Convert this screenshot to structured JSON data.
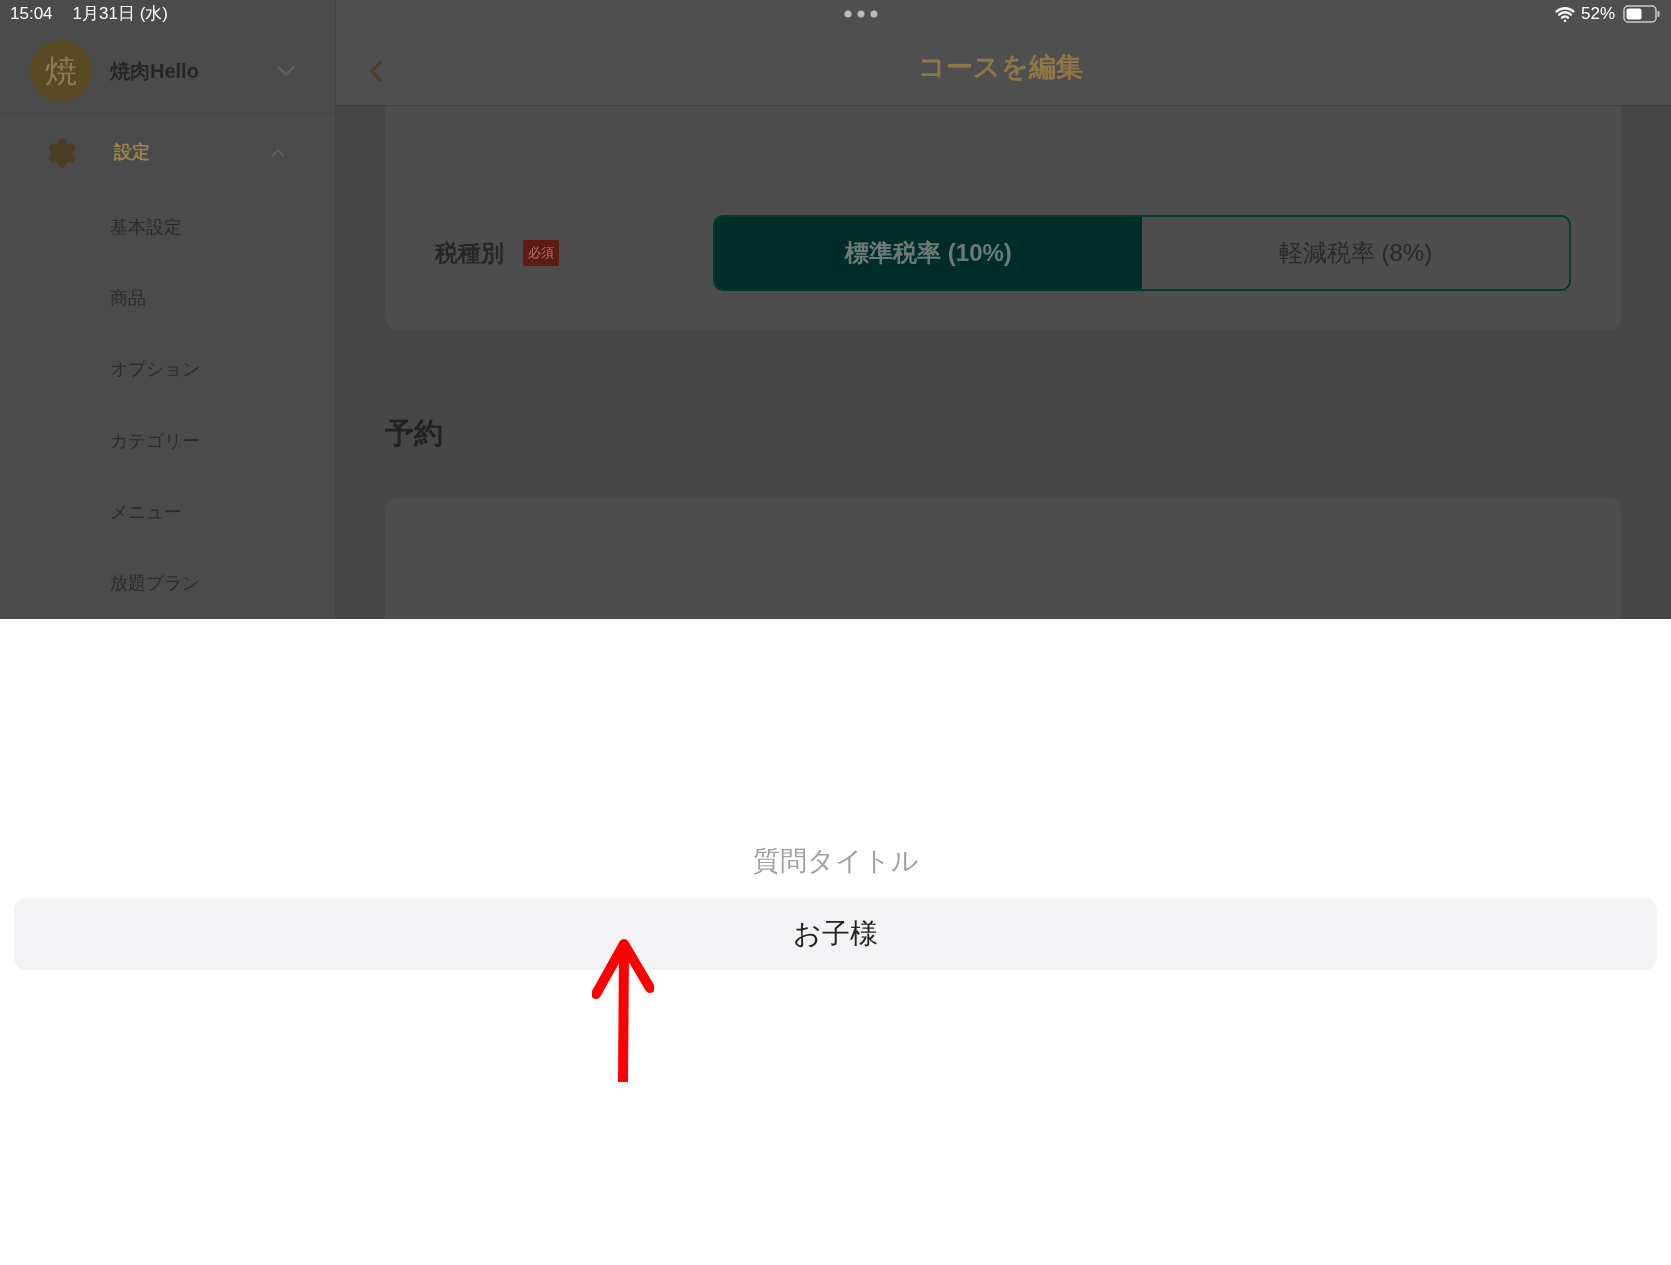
{
  "status_bar": {
    "time": "15:04",
    "date": "1月31日 (水)",
    "battery": "52%"
  },
  "sidebar": {
    "avatar": "焼",
    "store_name": "焼肉Hello",
    "group": {
      "label": "設定",
      "expanded": true,
      "items": [
        {
          "label": "基本設定"
        },
        {
          "label": "商品"
        },
        {
          "label": "オプション"
        },
        {
          "label": "カテゴリー"
        },
        {
          "label": "メニュー"
        },
        {
          "label": "放題プラン"
        }
      ]
    }
  },
  "header": {
    "title": "コースを編集"
  },
  "tax_type": {
    "label": "税種別",
    "badge": "必須",
    "options": [
      {
        "label": "標準税率 (10%)",
        "selected": true
      },
      {
        "label": "軽減税率 (8%)",
        "selected": false
      }
    ]
  },
  "section_title": "予約",
  "picker": {
    "title": "質問タイトル",
    "options": [
      {
        "label": "お子様",
        "selected": true
      }
    ]
  }
}
